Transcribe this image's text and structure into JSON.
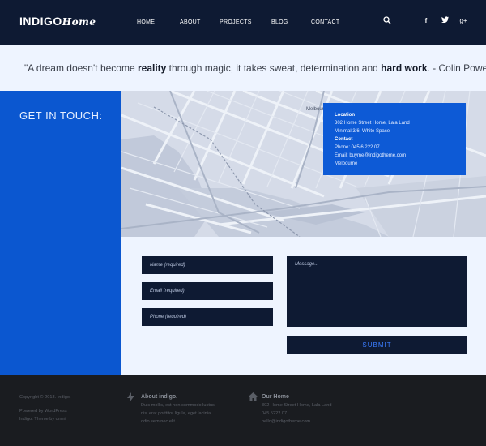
{
  "brand": {
    "logo_main": "INDIGO",
    "logo_script": "Home"
  },
  "nav": [
    "HOME",
    "ABOUT",
    "PROJECTS",
    "BLOG",
    "CONTACT"
  ],
  "header_icons": [
    "search-icon",
    "facebook-icon",
    "twitter-icon",
    "google-plus-icon"
  ],
  "quote": {
    "part1": "\"A dream doesn't become ",
    "bold1": "reality",
    "part2": " through magic, it takes sweat, determination and ",
    "bold2": "hard work",
    "part3": ". - Colin Powell"
  },
  "contact": {
    "title": "GET IN TOUCH:",
    "map_label": "Melbourne",
    "location_label": "Location",
    "address1": "302 Home Street Home, Lala Land",
    "address2": "Minimal 3/6, White Space",
    "contact_label": "Contact",
    "phone": "Phone: 045 6 222 07",
    "email": "Email: buyme@indigotheme.com",
    "city": "Melbourne"
  },
  "form": {
    "name_placeholder": "Name (required)",
    "email_placeholder": "Email (required)",
    "phone_placeholder": "Phone (required)",
    "message_placeholder": "Message...",
    "submit_label": "SUBMIT"
  },
  "footer": {
    "copyright": "Copyright © 2013. Indigo.",
    "powered1": "Powered by WordPress",
    "powered2": "Indigo. Theme by omni",
    "about_title": "About indigo.",
    "about_l1": "Duis mollis, est non commodo luctus,",
    "about_l2": "nisi erat porttitor ligula, eget lacinia",
    "about_l3": "odio sem nec elit.",
    "home_title": "Our Home",
    "home_l1": "302 Home Street Home, Lala Land",
    "home_l2": "045 5222 07",
    "home_l3": "hello@indigotheme.com"
  }
}
